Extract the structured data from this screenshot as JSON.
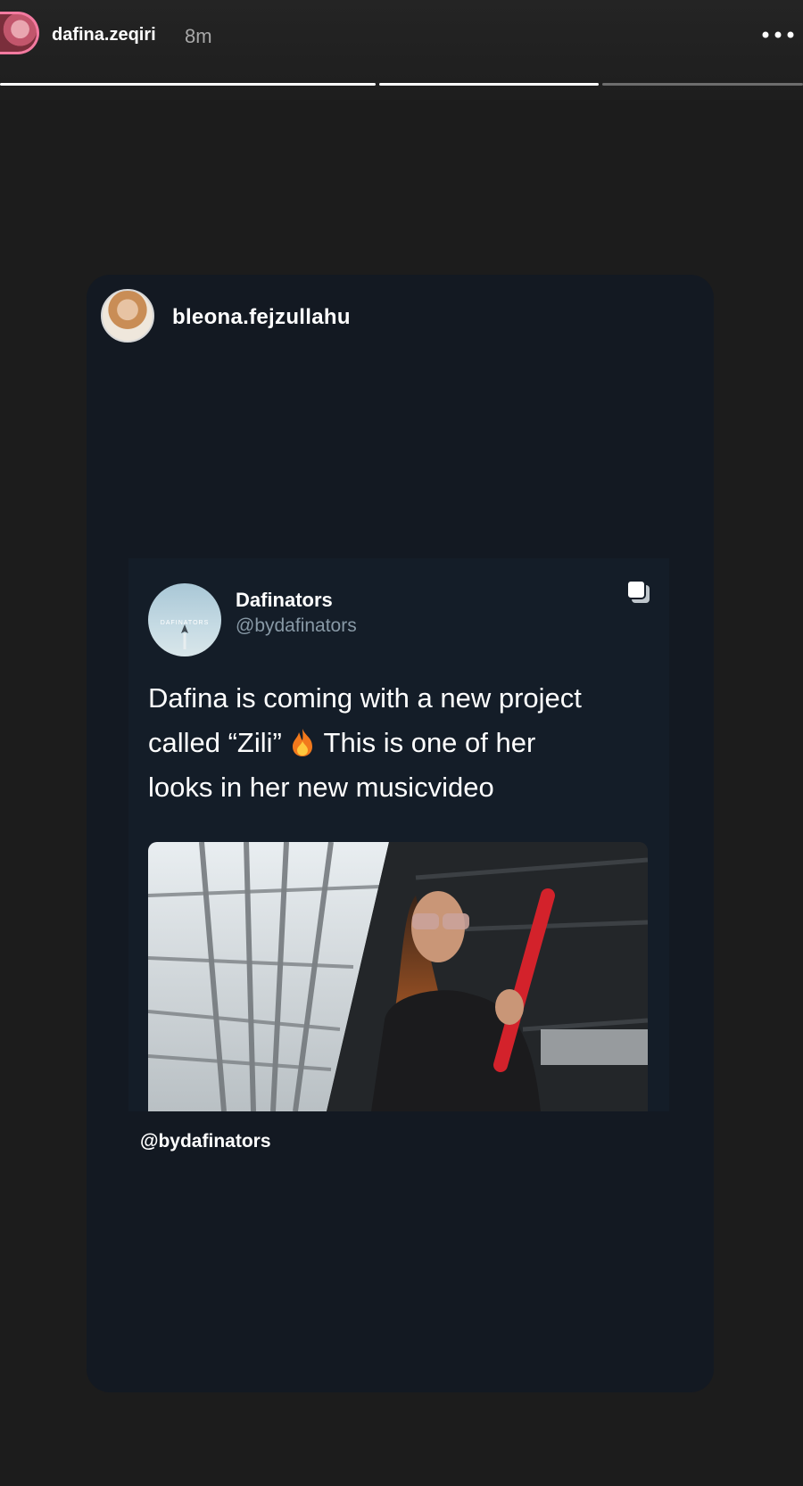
{
  "story": {
    "author": "dafina.zeqiri",
    "time": "8m",
    "progress": [
      1,
      1,
      0
    ]
  },
  "shared_post": {
    "sharer": "bleona.fejzullahu",
    "credit": "@bydafinators",
    "tweet": {
      "name": "Dafinators",
      "handle": "@bydafinators",
      "avatar_text": "DAFINATORS",
      "text_line1": "Dafina is coming with a new project",
      "text_line2_start": "called “Zili” ",
      "text_line2_end": "  This is one of her",
      "text_line3": "looks in her new musicvideo"
    }
  },
  "colors": {
    "background": "#1c1c1c",
    "card": "#131922",
    "tweet_bg": "#141d28",
    "handle_gray": "#8899a6",
    "bat_red": "#d3222b"
  },
  "icons": {
    "more": "more-horizontal-icon",
    "copy": "copy-icon",
    "fire": "fire-emoji-icon"
  }
}
